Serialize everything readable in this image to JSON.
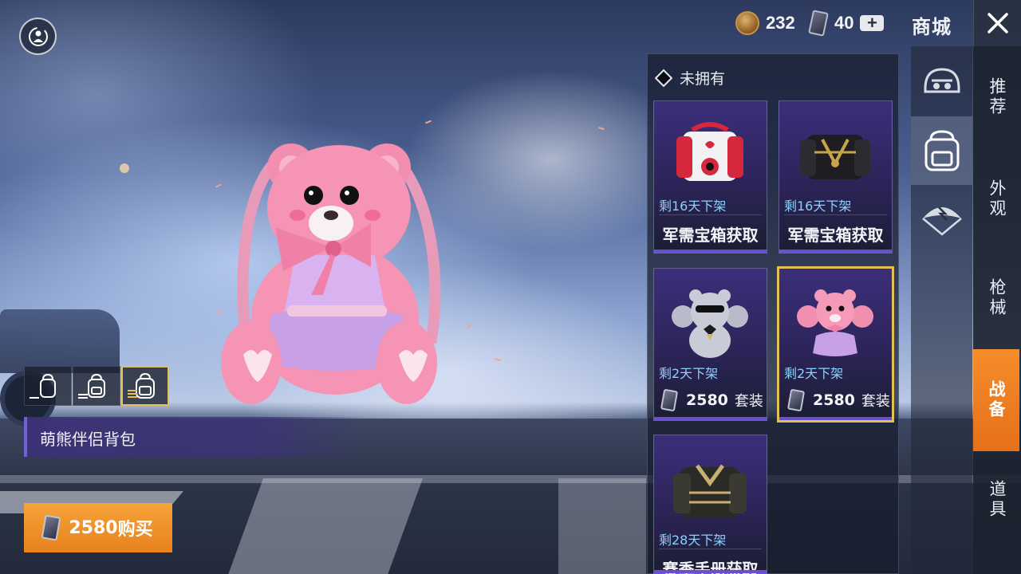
{
  "topbar": {
    "coin_amount": "232",
    "uc_amount": "40",
    "shop_title": "商城"
  },
  "right_nav": [
    {
      "label": "推荐",
      "active": false
    },
    {
      "label": "外观",
      "active": false
    },
    {
      "label": "枪械",
      "active": false
    },
    {
      "label": "战备",
      "active": true
    },
    {
      "label": "道具",
      "active": false
    }
  ],
  "categories": [
    {
      "icon": "helmet-icon",
      "active": false
    },
    {
      "icon": "backpack-icon",
      "active": true
    },
    {
      "icon": "parachute-icon",
      "active": false
    }
  ],
  "list": {
    "header": "未拥有",
    "cards": [
      {
        "art": "red-backpack",
        "timer": "剩16天下架",
        "source": "军需宝箱获取",
        "selected": false
      },
      {
        "art": "black-gold-backpack",
        "timer": "剩16天下架",
        "source": "军需宝箱获取",
        "selected": false
      },
      {
        "art": "grey-bear-backpack",
        "timer": "剩2天下架",
        "price": "2580",
        "price_suffix": "套装",
        "selected": false
      },
      {
        "art": "pink-bear-backpack",
        "timer": "剩2天下架",
        "price": "2580",
        "price_suffix": "套装",
        "selected": true
      },
      {
        "art": "gold-armor-backpack",
        "timer": "剩28天下架",
        "source": "赛季手册获取",
        "selected": false
      }
    ]
  },
  "preview": {
    "item_name": "萌熊伴侣背包",
    "variants": [
      {
        "level": 1,
        "selected": false
      },
      {
        "level": 2,
        "selected": false
      },
      {
        "level": 3,
        "selected": true
      }
    ]
  },
  "buy_button": {
    "price": "2580",
    "label": "购买"
  },
  "colors": {
    "accent_orange": "#f08a25",
    "selected_gold": "#e2c057",
    "timer_blue": "#8dd0ff",
    "card_purple": "#3b2f7a"
  }
}
